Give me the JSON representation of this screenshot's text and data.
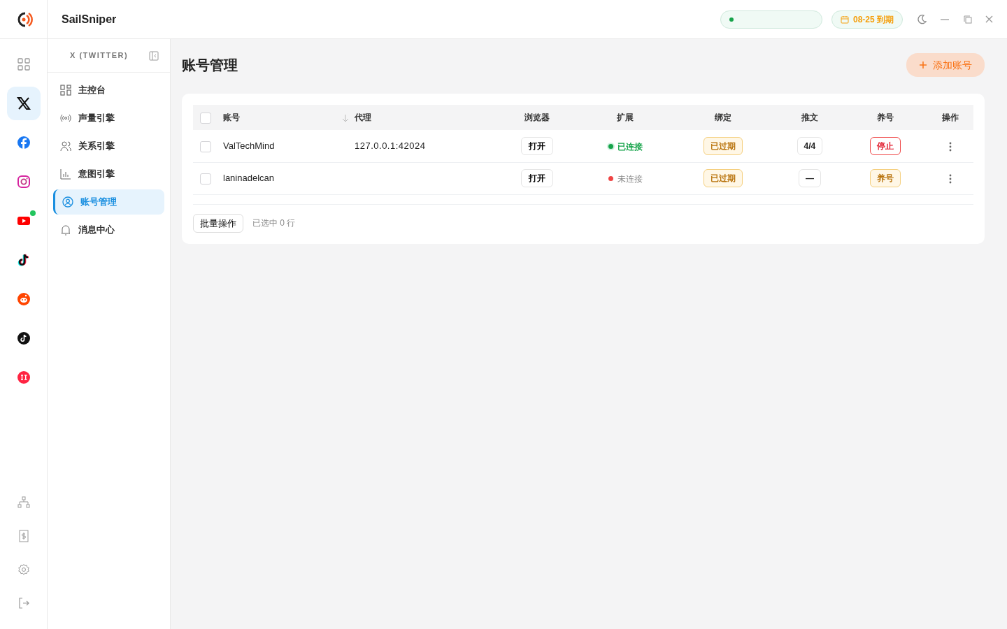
{
  "app": {
    "name": "SailSniper"
  },
  "header": {
    "badges": [
      {
        "kind": "token"
      },
      {
        "kind": "expiry",
        "text": "08-25 到期"
      }
    ]
  },
  "rail": {
    "platforms": [
      {
        "kind": "grid",
        "selected": false,
        "notification": false
      },
      {
        "kind": "x",
        "selected": true,
        "notification": false
      },
      {
        "kind": "facebook",
        "selected": false,
        "notification": false
      },
      {
        "kind": "instagram",
        "selected": false,
        "notification": false
      },
      {
        "kind": "youtube",
        "selected": false,
        "notification": true
      },
      {
        "kind": "tiktok",
        "selected": false,
        "notification": false
      },
      {
        "kind": "reddit",
        "selected": false,
        "notification": false
      },
      {
        "kind": "tiktok-round",
        "selected": false,
        "notification": false
      },
      {
        "kind": "xiaohongshu",
        "selected": false,
        "notification": false
      }
    ],
    "bottom": [
      {
        "kind": "network"
      },
      {
        "kind": "billing"
      },
      {
        "kind": "settings"
      },
      {
        "kind": "logout"
      }
    ]
  },
  "sidebar": {
    "title": "X (TWITTER)",
    "items": [
      {
        "label": "主控台",
        "kind": "grid",
        "selected": false
      },
      {
        "label": "声量引擎",
        "kind": "signal",
        "selected": false
      },
      {
        "label": "关系引擎",
        "kind": "users",
        "selected": false
      },
      {
        "label": "意图引擎",
        "kind": "chart",
        "selected": false
      },
      {
        "label": "账号管理",
        "kind": "user",
        "selected": true
      },
      {
        "label": "消息中心",
        "kind": "bell",
        "selected": false
      }
    ]
  },
  "page": {
    "title": "账号管理",
    "add_button": "添加账号"
  },
  "table": {
    "select_all": {
      "checked": false
    },
    "columns": [
      "账号",
      "代理",
      "浏览器",
      "扩展",
      "绑定",
      "推文",
      "养号",
      "操作"
    ],
    "rows": [
      {
        "checked": false,
        "account": "ValTechMind",
        "proxy": "127.0.0.1:42024",
        "browser": "打开",
        "extension": {
          "text": "已连接",
          "connected": true
        },
        "binding": "已过期",
        "posts": "4/4",
        "nurture": {
          "kind": "stop",
          "text": "停止"
        }
      },
      {
        "checked": false,
        "account": "laninadelcan",
        "browser": "打开",
        "extension": {
          "text": "未连接",
          "connected": false
        },
        "binding": "已过期",
        "posts": "—",
        "nurture": {
          "kind": "start",
          "text": "养号"
        }
      }
    ]
  },
  "footer": {
    "batch_button": "批量操作",
    "selection": "已选中 0 行"
  }
}
